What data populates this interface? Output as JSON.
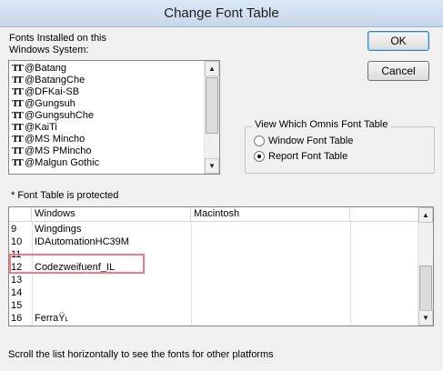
{
  "window": {
    "title": "Change Font Table"
  },
  "installed_label": "Fonts Installed on this Windows System:",
  "font_list": [
    "@Batang",
    "@BatangChe",
    "@DFKai-SB",
    "@Gungsuh",
    "@GungsuhChe",
    "@KaiTi",
    "@MS Mincho",
    "@MS PMincho",
    "@Malgun Gothic"
  ],
  "font_list_icon": "truetype-font-icon",
  "buttons": {
    "ok": "OK",
    "cancel": "Cancel"
  },
  "group": {
    "title": "View Which Omnis Font Table",
    "options": [
      {
        "label": "Window Font Table",
        "selected": false
      },
      {
        "label": "Report Font Table",
        "selected": true
      }
    ]
  },
  "protected_note": "* Font Table is protected",
  "table": {
    "columns": [
      "Windows",
      "Macintosh"
    ],
    "rows": [
      {
        "num": "9",
        "windows": "Wingdings"
      },
      {
        "num": "10",
        "windows": "IDAutomationHC39M"
      },
      {
        "num": "11",
        "windows": ""
      },
      {
        "num": "12",
        "windows": "Codezweifuenf_IL"
      },
      {
        "num": "13",
        "windows": ""
      },
      {
        "num": "14",
        "windows": ""
      },
      {
        "num": "15",
        "windows": ""
      },
      {
        "num": "16",
        "windows": "FerraŸ˪"
      }
    ]
  },
  "footer": "Scroll the list horizontally to see the fonts for other platforms",
  "colors": {
    "highlight": "#f27a85",
    "titlebar": "#c7d8ec"
  }
}
